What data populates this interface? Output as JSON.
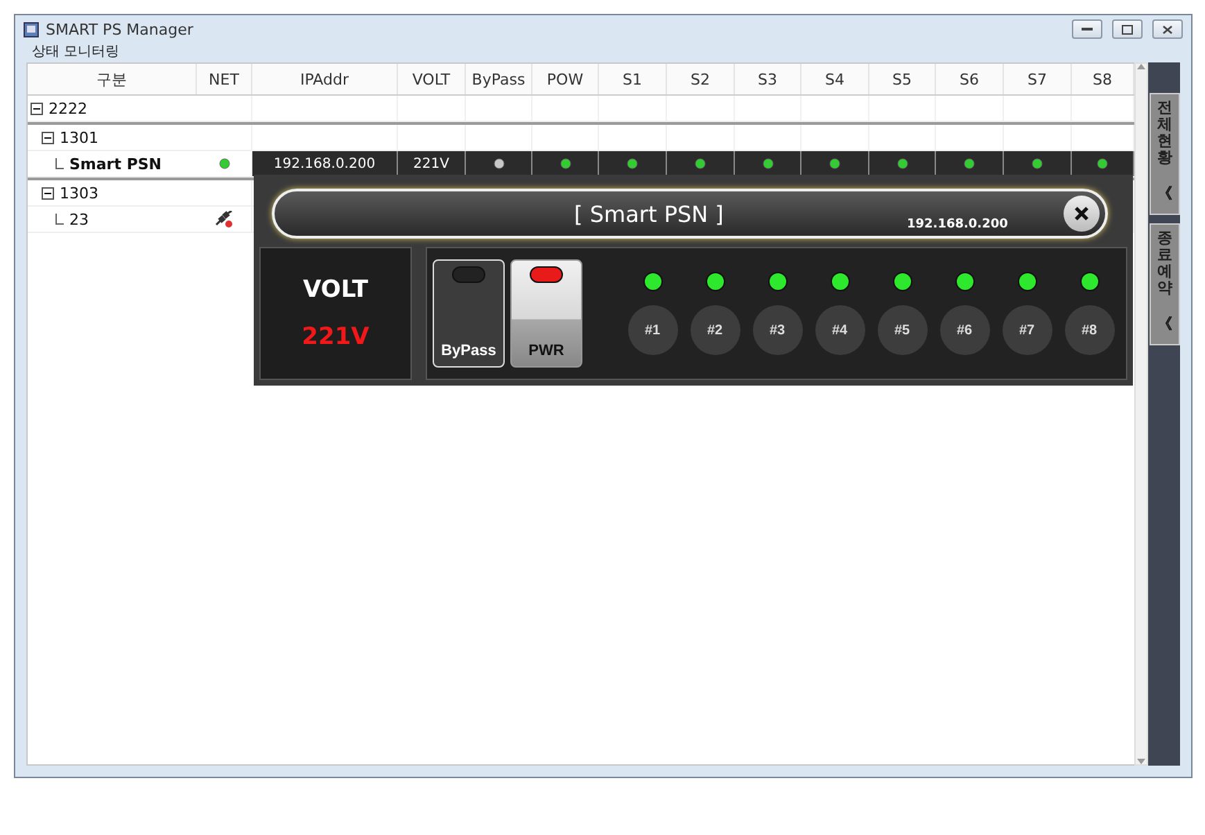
{
  "window": {
    "title": "SMART PS Manager"
  },
  "menu": [
    {
      "label": "상태 모니터링"
    }
  ],
  "columns": [
    "구분",
    "NET",
    "IPAddr",
    "VOLT",
    "ByPass",
    "POW",
    "S1",
    "S2",
    "S3",
    "S4",
    "S5",
    "S6",
    "S7",
    "S8"
  ],
  "tree": [
    {
      "kind": "group",
      "label": "2222",
      "expanded": true,
      "children": [
        {
          "kind": "group",
          "label": "1301",
          "expanded": true,
          "children": [
            {
              "kind": "device",
              "label": "Smart PSN",
              "connected": true,
              "ip": "192.168.0.200",
              "volt": "221V",
              "bypass": false,
              "power": true,
              "slots": [
                true,
                true,
                true,
                true,
                true,
                true,
                true,
                true
              ]
            }
          ]
        },
        {
          "kind": "group",
          "label": "1303",
          "expanded": true,
          "children": [
            {
              "kind": "device",
              "label": "23",
              "connected": false
            }
          ]
        }
      ]
    }
  ],
  "popup": {
    "title": "[ Smart PSN ]",
    "ip": "192.168.0.200",
    "volt_label": "VOLT",
    "volt_value": "221V",
    "buttons": [
      {
        "label": "ByPass",
        "on": false
      },
      {
        "label": "PWR",
        "on": true
      }
    ],
    "slots": [
      {
        "label": "#1",
        "on": true
      },
      {
        "label": "#2",
        "on": true
      },
      {
        "label": "#3",
        "on": true
      },
      {
        "label": "#4",
        "on": true
      },
      {
        "label": "#5",
        "on": true
      },
      {
        "label": "#6",
        "on": true
      },
      {
        "label": "#7",
        "on": true
      },
      {
        "label": "#8",
        "on": true
      }
    ]
  },
  "side_tabs": [
    {
      "label": "전체현황",
      "arrow": "《"
    },
    {
      "label": "종료예약",
      "arrow": "《"
    }
  ]
}
